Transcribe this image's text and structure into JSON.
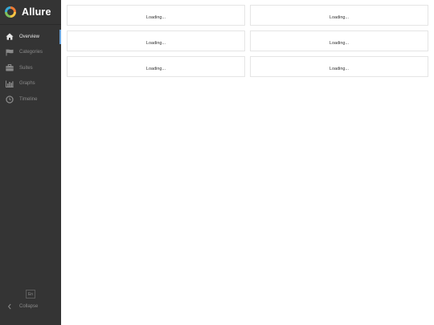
{
  "app": {
    "name": "Allure"
  },
  "sidebar": {
    "items": [
      {
        "label": "Overview",
        "icon": "home-icon"
      },
      {
        "label": "Categories",
        "icon": "flag-icon"
      },
      {
        "label": "Suites",
        "icon": "briefcase-icon"
      },
      {
        "label": "Graphs",
        "icon": "bar-chart-icon"
      },
      {
        "label": "Timeline",
        "icon": "clock-icon"
      }
    ],
    "active_index": 0,
    "language": "En",
    "collapse_label": "Collapse"
  },
  "widgets": [
    {
      "status": "Loading..."
    },
    {
      "status": "Loading..."
    },
    {
      "status": "Loading..."
    },
    {
      "status": "Loading..."
    },
    {
      "status": "Loading..."
    },
    {
      "status": "Loading..."
    }
  ],
  "colors": {
    "sidebar_bg": "#343434",
    "accent": "#6aa4dc",
    "logo": [
      "#ef7a33",
      "#f6c445",
      "#7ec05a",
      "#39a9d6"
    ]
  }
}
